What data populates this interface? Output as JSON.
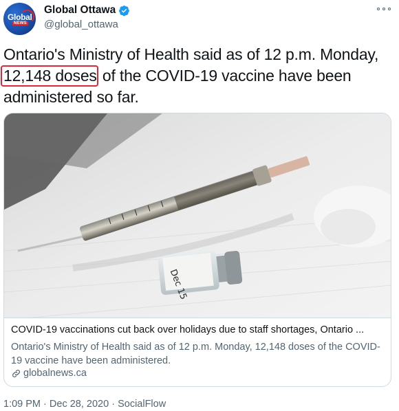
{
  "author": {
    "display_name": "Global Ottawa",
    "handle": "@global_ottawa",
    "verified": true,
    "avatar_text": "Global",
    "avatar_subtext": "NEWS"
  },
  "tweet": {
    "text_before": "Ontario's Ministry of Health said as of 12 p.m. Monday, ",
    "text_highlight": "12,148 doses",
    "text_after": " of the COVID-19 vaccine have been administered so far.",
    "highlight_color": "#d8283a"
  },
  "card": {
    "image_alt_icon": "vaccine-syringe-vial-image",
    "title": "COVID-19 vaccinations cut back over holidays due to staff shortages, Ontario ...",
    "description": "Ontario's Ministry of Health said as of 12 p.m. Monday, 12,148 doses of the COVID-19 vaccine have been administered.",
    "domain": "globalnews.ca",
    "vial_label": "Dec 15"
  },
  "meta": {
    "time": "1:09 PM",
    "date": "Dec 28, 2020",
    "source": "SocialFlow",
    "separator": "·"
  },
  "colors": {
    "verified_blue": "#1d9bf0",
    "secondary_text": "#536471",
    "border": "#cfd9de"
  }
}
